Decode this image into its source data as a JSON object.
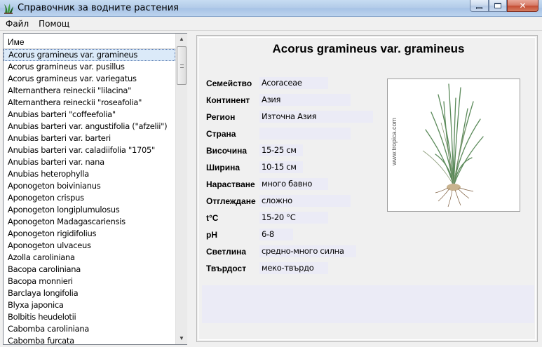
{
  "window": {
    "title": "Справочник за водните растения"
  },
  "menu": [
    {
      "label": "Файл"
    },
    {
      "label": "Помощ"
    }
  ],
  "list": {
    "header": "Име",
    "selected_index": 0,
    "items": [
      "Acorus gramineus var. gramineus",
      "Acorus gramineus var. pusillus",
      "Acorus gramineus var. variegatus",
      "Alternanthera reineckii \"lilacina\"",
      "Alternanthera reineckii \"roseafolia\"",
      "Anubias barteri \"coffeefolia\"",
      "Anubias barteri var. angustifolia (\"afzelii\")",
      "Anubias barteri var. barteri",
      "Anubias barteri var. caladiifolia \"1705\"",
      "Anubias barteri var. nana",
      "Anubias heterophylla",
      "Aponogeton boivinianus",
      "Aponogeton crispus",
      "Aponogeton longiplumulosus",
      "Aponogeton Madagascariensis",
      "Aponogeton rigidifolius",
      "Aponogeton ulvaceus",
      "Azolla caroliniana",
      "Bacopa caroliniana",
      "Bacopa monnieri",
      "Barclaya longifolia",
      "Blyxa japonica",
      "Bolbitis heudelotii",
      "Cabomba caroliniana",
      "Cabomba furcata"
    ]
  },
  "detail": {
    "title": "Acorus gramineus var. gramineus",
    "fields": [
      {
        "label": "Семейство",
        "value": "Acoraceae"
      },
      {
        "label": "Континент",
        "value": "Азия"
      },
      {
        "label": "Регион",
        "value": "Източна Азия"
      },
      {
        "label": "Страна",
        "value": ""
      },
      {
        "label": "Височина",
        "value": "15-25 см"
      },
      {
        "label": "Ширина",
        "value": "10-15 см"
      },
      {
        "label": "Нарастване",
        "value": "много бавно"
      },
      {
        "label": "Отглеждане",
        "value": "сложно"
      },
      {
        "label": "t°C",
        "value": "15-20 °C"
      },
      {
        "label": "pH",
        "value": "6-8"
      },
      {
        "label": "Светлина",
        "value": "средно-много силна"
      },
      {
        "label": "Твърдост",
        "value": "меко-твърдо"
      }
    ],
    "photo_watermark": "www.tropica.com"
  },
  "colors": {
    "field_bg": "#ebebf6",
    "selection": "#dbeaf9",
    "titlebar": "#b2cbe8"
  },
  "icons": {
    "app": "plant-icon",
    "minimize": "minimize-icon",
    "maximize": "maximize-icon",
    "close": "close-icon"
  }
}
